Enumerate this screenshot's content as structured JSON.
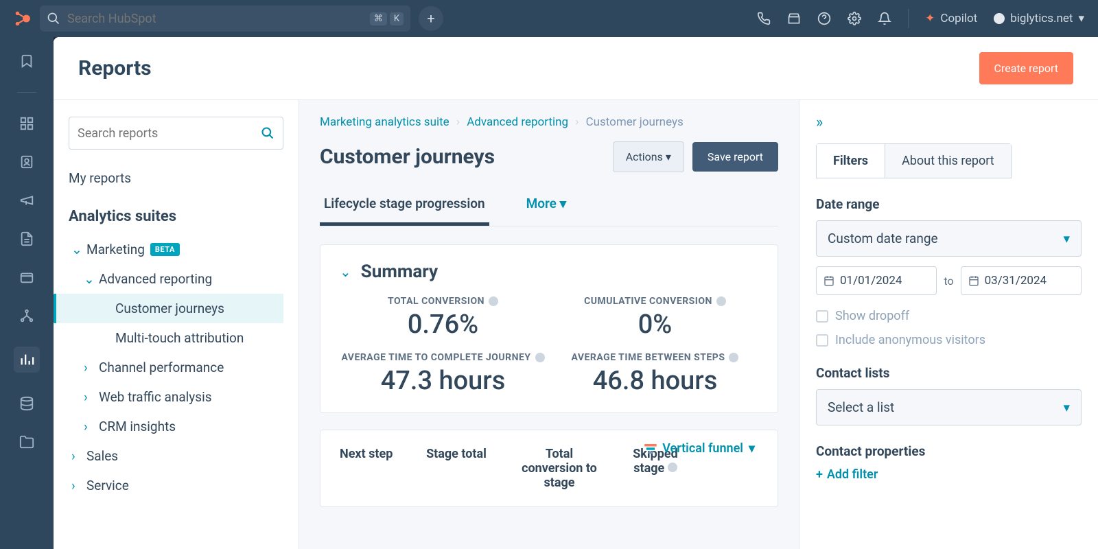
{
  "topbar": {
    "search_placeholder": "Search HubSpot",
    "kbd1": "⌘",
    "kbd2": "K",
    "copilot": "Copilot",
    "account": "biglytics.net"
  },
  "header": {
    "title": "Reports",
    "create_btn": "Create report"
  },
  "sidebar": {
    "search_placeholder": "Search reports",
    "my_reports": "My reports",
    "suites_head": "Analytics suites",
    "marketing": "Marketing",
    "beta": "BETA",
    "advanced_reporting": "Advanced reporting",
    "customer_journeys": "Customer journeys",
    "multi_touch": "Multi-touch attribution",
    "channel_perf": "Channel performance",
    "web_traffic": "Web traffic analysis",
    "crm_insights": "CRM insights",
    "sales": "Sales",
    "service": "Service"
  },
  "center": {
    "bc1": "Marketing analytics suite",
    "bc2": "Advanced reporting",
    "bc3": "Customer journeys",
    "title": "Customer journeys",
    "actions": "Actions",
    "save": "Save report",
    "tab_lifecycle": "Lifecycle stage progression",
    "tab_more": "More",
    "summary": "Summary",
    "m1_label": "TOTAL CONVERSION",
    "m1_value": "0.76%",
    "m2_label": "CUMULATIVE CONVERSION",
    "m2_value": "0%",
    "m3_label": "AVERAGE TIME TO COMPLETE JOURNEY",
    "m3_value": "47.3 hours",
    "m4_label": "AVERAGE TIME BETWEEN STEPS",
    "m4_value": "46.8 hours",
    "funnel_toggle": "Vertical funnel",
    "col_next": "Next step",
    "col_total": "Stage total",
    "col_conv": "Total conversion to stage",
    "col_skip": "Skipped stage"
  },
  "right": {
    "tab_filters": "Filters",
    "tab_about": "About this report",
    "date_range": "Date range",
    "date_select": "Custom date range",
    "date_from": "01/01/2024",
    "to": "to",
    "date_to": "03/31/2024",
    "show_dropoff": "Show dropoff",
    "include_anon": "Include anonymous visitors",
    "contact_lists": "Contact lists",
    "select_list": "Select a list",
    "contact_props": "Contact properties",
    "add_filter": "Add filter"
  }
}
